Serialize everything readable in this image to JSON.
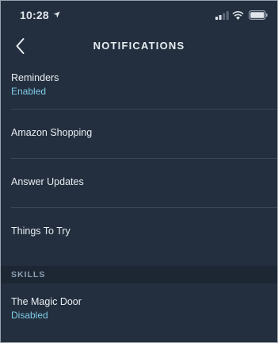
{
  "status_bar": {
    "time": "10:28"
  },
  "header": {
    "title": "NOTIFICATIONS"
  },
  "rows": [
    {
      "title": "Reminders",
      "subtitle": "Enabled"
    },
    {
      "title": "Amazon Shopping"
    },
    {
      "title": "Answer Updates"
    },
    {
      "title": "Things To Try"
    }
  ],
  "skills_section": {
    "label": "SKILLS",
    "items": [
      {
        "title": "The Magic Door",
        "subtitle": "Disabled"
      }
    ]
  },
  "colors": {
    "background": "#232f3e",
    "section_background": "#1d2734",
    "subtitle_accent": "#7fcce8",
    "text": "#e8edf2"
  },
  "icons": [
    "location-arrow-icon",
    "cellular-signal-icon",
    "wifi-icon",
    "battery-icon",
    "chevron-left-icon"
  ]
}
